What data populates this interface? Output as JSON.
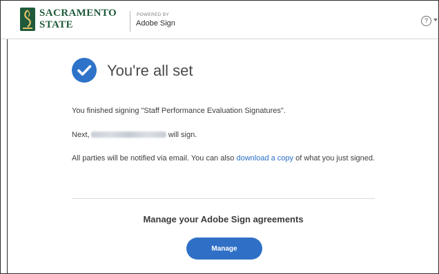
{
  "header": {
    "brand_line1": "SACRAMENTO",
    "brand_line2": "STATE",
    "powered_by": "POWERED BY",
    "product_name": "Adobe Sign",
    "help_icon": "?"
  },
  "main": {
    "title": "You're all set",
    "finished_text": "You finished signing \"Staff Performance Evaluation Signatures\".",
    "next_prefix": "Next,",
    "next_suffix": "will sign.",
    "notify_text": "All parties will be notified via email. You can also",
    "download_link": "download a copy",
    "notify_suffix": "of what you just signed.",
    "manage_heading": "Manage your Adobe Sign agreements",
    "manage_button": "Manage"
  },
  "colors": {
    "brand_green": "#1f5a3a",
    "accent_blue": "#2e73c9",
    "link_blue": "#2a6fc7"
  },
  "icons": {
    "logo": "sacramento-state-logo",
    "success": "check-circle-icon",
    "help": "help-icon",
    "dropdown": "chevron-down-icon"
  }
}
